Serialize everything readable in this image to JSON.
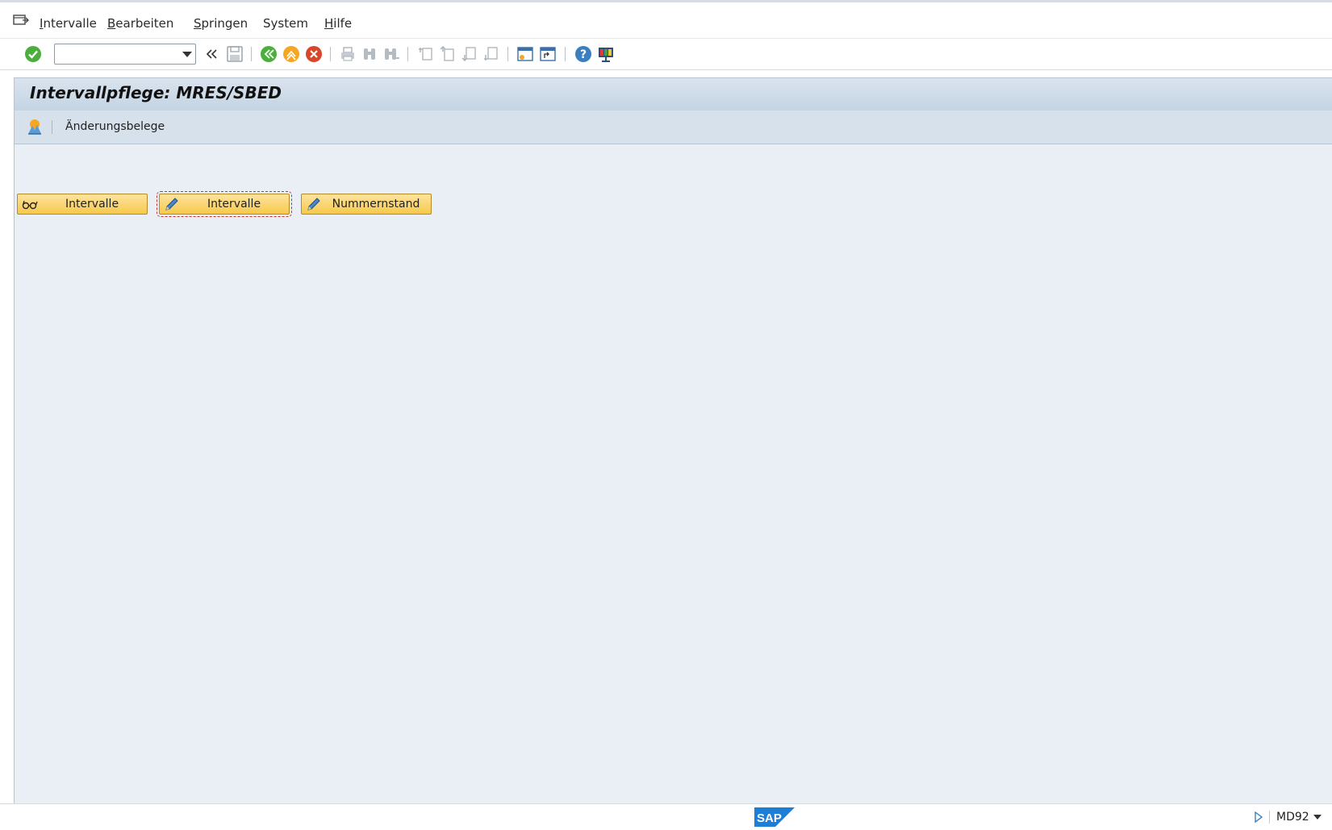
{
  "menu": {
    "items": [
      {
        "accel": "I",
        "rest": "ntervalle"
      },
      {
        "accel": "B",
        "rest": "earbeiten"
      },
      {
        "accel": "S",
        "rest": "pringen"
      },
      {
        "accel": "",
        "rest": "System"
      },
      {
        "accel": "H",
        "rest": "ilfe"
      }
    ]
  },
  "toolbar": {
    "command_value": "",
    "icons": [
      "enter-icon",
      "back-double-icon",
      "save-icon",
      "back-icon",
      "exit-icon",
      "cancel-icon",
      "print-icon",
      "find-icon",
      "find-next-icon",
      "first-page-icon",
      "previous-page-icon",
      "next-page-icon",
      "last-page-icon",
      "new-session-icon",
      "shortcut-icon",
      "help-icon",
      "customize-layout-icon"
    ]
  },
  "screen": {
    "title": "Intervallpflege: MRES/SBED",
    "app_toolbar": {
      "change_docs_label": "Änderungsbelege"
    },
    "buttons": [
      {
        "label": "Intervalle",
        "icon": "glasses-icon"
      },
      {
        "label": "Intervalle",
        "icon": "pencil-icon"
      },
      {
        "label": "Nummernstand",
        "icon": "pencil-icon"
      }
    ]
  },
  "status": {
    "logo_text": "SAP",
    "tcode": "MD92"
  },
  "colors": {
    "button_fill": "#f7c84a",
    "title_bg": "#c5d4e3",
    "content_bg": "#e9eff5"
  }
}
